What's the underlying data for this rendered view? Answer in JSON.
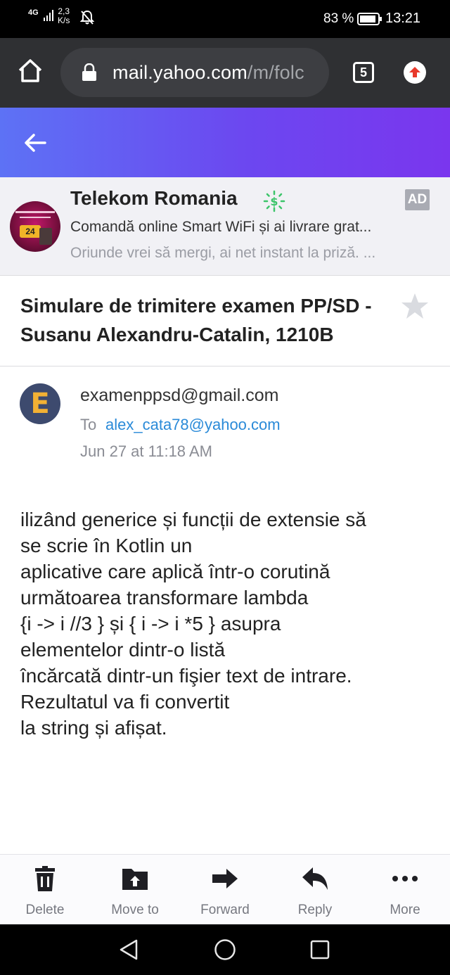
{
  "status_bar": {
    "network": "4G",
    "speed_value": "2,3",
    "speed_unit": "K/s",
    "battery": "83 %",
    "time": "13:21",
    "icons": [
      "signal-icon",
      "mute-bell-icon",
      "battery-icon"
    ]
  },
  "browser": {
    "url_main": "mail.yahoo.com",
    "url_path": "/m/folc",
    "tab_count": "5",
    "icons": [
      "home-icon",
      "lock-icon",
      "tabs-icon",
      "update-icon"
    ]
  },
  "header": {
    "icons": [
      "back-arrow-icon"
    ]
  },
  "ad": {
    "title": "Telekom Romania",
    "badge": "AD",
    "line1": "Comandă online Smart WiFi și ai livrare grat...",
    "line2": "Oriunde vrei să mergi, ai net instant la priză. ...",
    "logo_text": "24"
  },
  "email": {
    "subject": "Simulare de trimitere examen PP/SD - Susanu Alexandru-Catalin, 1210B",
    "avatar_letter": "E",
    "from": "examenppsd@gmail.com",
    "to_label": "To",
    "to": "alex_cata78@yahoo.com",
    "date": "Jun 27 at 11:18 AM",
    "body_lines": [
      "ilizând generice și funcții de extensie să",
      "se scrie în Kotlin un",
      "aplicative care aplică într-o corutină",
      "următoarea transformare lambda",
      "{i -> i //3 } și { i -> i *5 } asupra",
      "elementelor dintr-o listă",
      "încărcată dintr-un fişier text de intrare.",
      "Rezultatul va fi convertit",
      "la string și afișat."
    ]
  },
  "toolbar": {
    "items": [
      {
        "label": "Delete",
        "icon": "trash-icon"
      },
      {
        "label": "Move to",
        "icon": "folder-move-icon"
      },
      {
        "label": "Forward",
        "icon": "forward-arrow-icon"
      },
      {
        "label": "Reply",
        "icon": "reply-arrow-icon"
      },
      {
        "label": "More",
        "icon": "more-dots-icon"
      }
    ]
  },
  "colors": {
    "header_gradient_start": "#5d72f5",
    "header_gradient_end": "#7a36ee",
    "link": "#2a8ad8",
    "browser_bar": "#2f3033"
  }
}
